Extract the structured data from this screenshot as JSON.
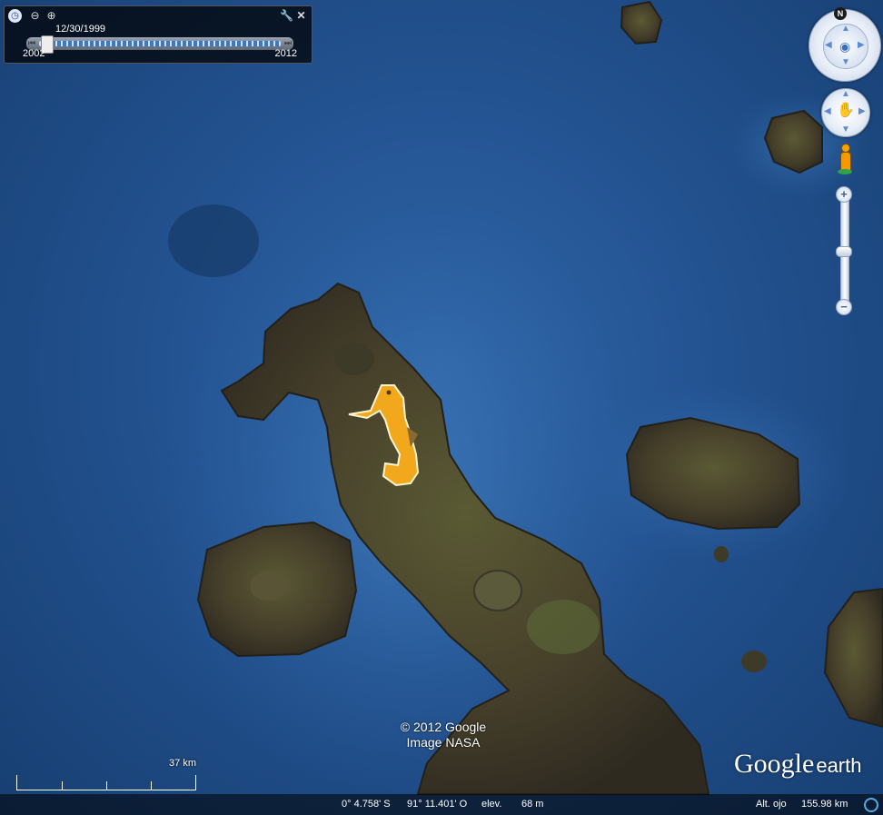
{
  "time_slider": {
    "current_date": "12/30/1999",
    "start_year": "2002",
    "end_year": "2012",
    "clock_icon": "clock-icon",
    "zoom_out_icon": "magnifier-minus-icon",
    "zoom_in_icon": "magnifier-plus-icon",
    "settings_icon": "wrench-icon",
    "close_icon": "close-icon",
    "close_glyph": "✕",
    "settings_glyph": "🔧",
    "zoom_out_glyph": "⊖",
    "zoom_in_glyph": "⊕",
    "prev_glyph": "⏮",
    "next_glyph": "⏭",
    "position_fraction": 0.03
  },
  "navigation": {
    "north_label": "N",
    "look_icon": "eye-icon",
    "move_icon": "hand-icon",
    "street_view_icon": "pegman-icon",
    "zoom_in_label": "+",
    "zoom_out_label": "−",
    "zoom_level_fraction": 0.5
  },
  "map": {
    "placemark_icon": "seahorse-icon",
    "copyright_line1": "© 2012 Google",
    "copyright_line2": "Image NASA",
    "scale_label": "37 km"
  },
  "logo": {
    "word1": "Google",
    "word2": "earth"
  },
  "status_bar": {
    "latitude": "0° 4.758' S",
    "longitude": "91° 11.401' O",
    "elevation_label": "elev.",
    "elevation_value": "68 m",
    "eye_alt_label": "Alt. ojo",
    "eye_alt_value": "155.98 km",
    "status_icon": "streaming-status-icon"
  },
  "colors": {
    "ocean": "#235290",
    "land": "#4a4a2e",
    "seahorse": "#f2a81d"
  }
}
